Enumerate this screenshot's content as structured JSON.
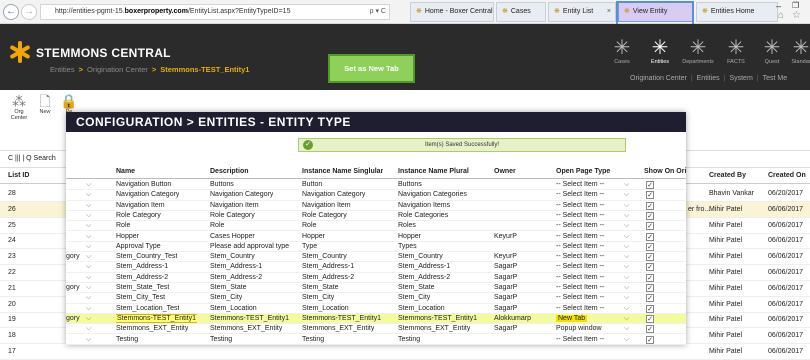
{
  "browser": {
    "url_prefix": "http://entities-pgmt-15.",
    "url_bold": "boxerproperty.com",
    "url_suffix": "/EntityList.aspx?EntityTypeID=15",
    "addr_icons": "ρ ▾ C",
    "tabs": [
      {
        "label": "Home - Boxer Central"
      },
      {
        "label": "Cases"
      },
      {
        "label": "Entity List"
      },
      {
        "label": "View Entity"
      },
      {
        "label": "Entities Home"
      }
    ]
  },
  "header": {
    "brand": "STEMMONS CENTRAL",
    "crumbs": [
      "Entities",
      "Origination Center",
      "Stemmons-TEST_Entity1"
    ],
    "green_note": "Set as New Tab",
    "nav": [
      {
        "label": "Cases",
        "icon": "asterisk-icon"
      },
      {
        "label": "Entities",
        "icon": "asterisk-icon"
      },
      {
        "label": "Departments",
        "icon": "asterisk-icon"
      },
      {
        "label": "FACTS",
        "icon": "asterisk-icon"
      },
      {
        "label": "Quest",
        "icon": "asterisk-icon"
      },
      {
        "label": "Standar",
        "icon": "asterisk-icon"
      }
    ],
    "subnav": [
      "Origination Center",
      "Entities",
      "System",
      "Test Me"
    ]
  },
  "toolbar": [
    {
      "label": "Org Center",
      "icon": "org-icon"
    },
    {
      "label": "New",
      "icon": "document-icon"
    },
    {
      "label": "Pe",
      "icon": "lock-icon"
    }
  ],
  "list": {
    "toolbar_text": "C  ||| | Q Search",
    "headers": {
      "id": "List ID",
      "created_by": "Created By",
      "created_on": "Created On"
    },
    "rows": [
      {
        "id": "28",
        "created_by": "Bhavin Vankar",
        "created_on": "06/20/2017",
        "extra": ""
      },
      {
        "id": "26",
        "created_by": "Mihir Patel",
        "created_on": "06/06/2017",
        "extra": "er fro..."
      },
      {
        "id": "25",
        "created_by": "Mihir Patel",
        "created_on": "06/06/2017",
        "extra": ""
      },
      {
        "id": "24",
        "created_by": "Mihir Patel",
        "created_on": "06/06/2017",
        "extra": ""
      },
      {
        "id": "23",
        "created_by": "Mihir Patel",
        "created_on": "06/06/2017",
        "extra": ""
      },
      {
        "id": "22",
        "created_by": "Mihir Patel",
        "created_on": "06/06/2017",
        "extra": ""
      },
      {
        "id": "21",
        "created_by": "Mihir Patel",
        "created_on": "06/06/2017",
        "extra": ""
      },
      {
        "id": "20",
        "created_by": "Mihir Patel",
        "created_on": "06/06/2017",
        "extra": ""
      },
      {
        "id": "19",
        "created_by": "Mihir Patel",
        "created_on": "06/06/2017",
        "extra": ""
      },
      {
        "id": "18",
        "created_by": "Mihir Patel",
        "created_on": "06/06/2017",
        "extra": ""
      },
      {
        "id": "17",
        "created_by": "Mihir Patel",
        "created_on": "06/06/2017",
        "extra": ""
      }
    ]
  },
  "overlay": {
    "title": "CONFIGURATION > ENTITIES - ENTITY TYPE",
    "toast": "Item(s) Saved Successfully!",
    "headers": {
      "name": "Name",
      "description": "Description",
      "singular": "Instance Name Singlular",
      "plural": "Instance Name Plural",
      "owner": "Owner",
      "open_page": "Open Page Type",
      "show_on": "Show On Ori"
    },
    "rows": [
      {
        "prefix": "",
        "name": "Navigation Button",
        "description": "Buttons",
        "singular": "Button",
        "plural": "Buttons",
        "owner": "",
        "open_page": "-- Select Item --",
        "checked": true
      },
      {
        "prefix": "",
        "name": "Navigation Category",
        "description": "Navigation Category",
        "singular": "Navigation Category",
        "plural": "Navigation Categories",
        "owner": "",
        "open_page": "-- Select Item --",
        "checked": true
      },
      {
        "prefix": "",
        "name": "Navigation Item",
        "description": "Navigation Item",
        "singular": "Navigation Item",
        "plural": "Navigation Items",
        "owner": "",
        "open_page": "-- Select Item --",
        "checked": true
      },
      {
        "prefix": "",
        "name": "Role Category",
        "description": "Role Category",
        "singular": "Role Category",
        "plural": "Role Categories",
        "owner": "",
        "open_page": "-- Select Item --",
        "checked": true
      },
      {
        "prefix": "",
        "name": "Role",
        "description": "Role",
        "singular": "Role",
        "plural": "Roles",
        "owner": "",
        "open_page": "-- Select Item --",
        "checked": true
      },
      {
        "prefix": "",
        "name": "Hopper",
        "description": "Cases Hopper",
        "singular": "Hopper",
        "plural": "Hopper",
        "owner": "KeyurP",
        "open_page": "-- Select Item --",
        "checked": true
      },
      {
        "prefix": "",
        "name": "Approval Type",
        "description": "Please add approval type",
        "singular": "Type",
        "plural": "Types",
        "owner": "",
        "open_page": "-- Select Item --",
        "checked": true
      },
      {
        "prefix": "gory",
        "name": "Stem_Country_Test",
        "description": "Stem_Country",
        "singular": "Stem_Country",
        "plural": "Stem_Country",
        "owner": "KeyurP",
        "open_page": "-- Select Item --",
        "checked": true
      },
      {
        "prefix": "",
        "name": "Stem_Address-1",
        "description": "Stem_Address-1",
        "singular": "Stem_Address-1",
        "plural": "Stem_Address-1",
        "owner": "SagarP",
        "open_page": "-- Select Item --",
        "checked": true
      },
      {
        "prefix": "",
        "name": "Stem_Address-2",
        "description": "Stem_Address-2",
        "singular": "Stem_Address-2",
        "plural": "Stem_Address-2",
        "owner": "SagarP",
        "open_page": "-- Select Item --",
        "checked": true
      },
      {
        "prefix": "gory",
        "name": "Stem_State_Test",
        "description": "Stem_State",
        "singular": "Stem_State",
        "plural": "Stem_State",
        "owner": "SagarP",
        "open_page": "-- Select Item --",
        "checked": true
      },
      {
        "prefix": "",
        "name": "Stem_City_Test",
        "description": "Stem_City",
        "singular": "Stem_City",
        "plural": "Stem_City",
        "owner": "SagarP",
        "open_page": "-- Select Item --",
        "checked": true
      },
      {
        "prefix": "",
        "name": "Stem_Location_Test",
        "description": "Stem_Location",
        "singular": "Stem_Location",
        "plural": "Stem_Location",
        "owner": "SagarP",
        "open_page": "-- Select Item --",
        "checked": true
      },
      {
        "prefix": "gory",
        "name": "Stemmons-TEST_Entity1",
        "description": "Stemmons-TEST_Entity1",
        "singular": "Stemmons-TEST_Entity1",
        "plural": "Stemmons-TEST_Entity1",
        "owner": "Alokkumarp",
        "open_page": "New Tab",
        "checked": true
      },
      {
        "prefix": "",
        "name": "Stemmons_EXT_Entity",
        "description": "Stemmons_EXT_Entity",
        "singular": "Stemmons_EXT_Entity",
        "plural": "Stemmons_EXT_Entity",
        "owner": "SagarP",
        "open_page": "Popup window",
        "checked": true
      },
      {
        "prefix": "",
        "name": "Testing",
        "description": "Testing",
        "singular": "Testing",
        "plural": "Testing",
        "owner": "",
        "open_page": "-- Select Item --",
        "checked": true
      }
    ]
  },
  "window_controls": {
    "minimize": "–",
    "restore": "❐"
  }
}
